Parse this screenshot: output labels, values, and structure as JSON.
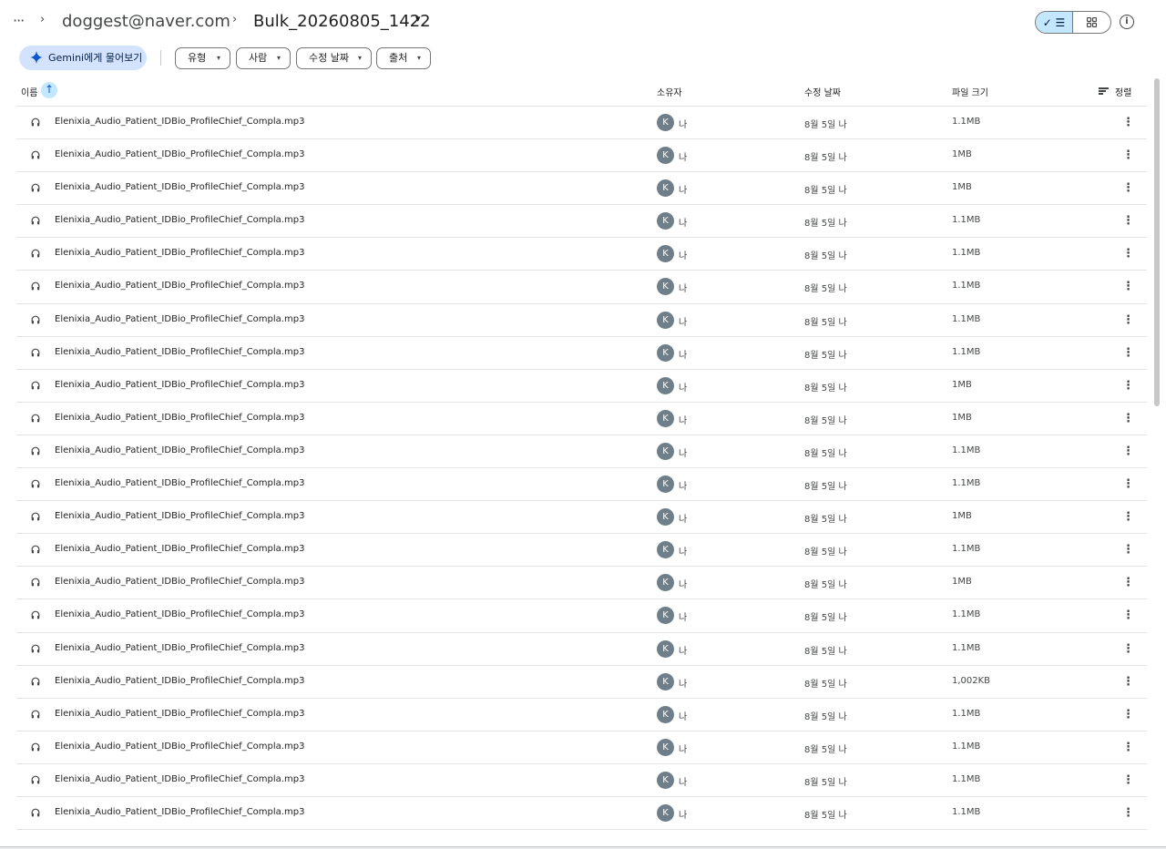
{
  "breadcrumb": {
    "more": "···",
    "separator": "›",
    "user": "doggest@naver.com",
    "folder": "Bulk_20260805_1422",
    "folder_caret": "▾"
  },
  "view_toggle": {
    "list_label": "✓ ☰",
    "grid_icon": "grid-icon",
    "list_selected": true
  },
  "info_icon": {
    "glyph": "i"
  },
  "chips": {
    "gemini": "Gemini에게 물어보기",
    "type": "유형",
    "people": "사람",
    "modified": "수정 날짜",
    "source": "출처",
    "caret": "▾"
  },
  "columns": {
    "name": "이름",
    "sort_arrow": "↑",
    "owner": "소유자",
    "modified": "수정 날짜",
    "size": "파일 크기",
    "sort": "정렬"
  },
  "colors": {
    "accent": "#c2e7ff",
    "gemini_chip": "#d3e3fd",
    "avatar": "#6e7f8a"
  },
  "rows": [
    {
      "name": "Elenixia_Audio_Patient_IDBio_ProfileChief_Compla.mp3",
      "avatar": "K",
      "owner": "나",
      "date": "8월 5일 나",
      "size": "1.1MB",
      "more": "⋮"
    },
    {
      "name": "Elenixia_Audio_Patient_IDBio_ProfileChief_Compla.mp3",
      "avatar": "K",
      "owner": "나",
      "date": "8월 5일 나",
      "size": "1MB",
      "more": "⋮"
    },
    {
      "name": "Elenixia_Audio_Patient_IDBio_ProfileChief_Compla.mp3",
      "avatar": "K",
      "owner": "나",
      "date": "8월 5일 나",
      "size": "1MB",
      "more": "⋮"
    },
    {
      "name": "Elenixia_Audio_Patient_IDBio_ProfileChief_Compla.mp3",
      "avatar": "K",
      "owner": "나",
      "date": "8월 5일 나",
      "size": "1.1MB",
      "more": "⋮"
    },
    {
      "name": "Elenixia_Audio_Patient_IDBio_ProfileChief_Compla.mp3",
      "avatar": "K",
      "owner": "나",
      "date": "8월 5일 나",
      "size": "1.1MB",
      "more": "⋮"
    },
    {
      "name": "Elenixia_Audio_Patient_IDBio_ProfileChief_Compla.mp3",
      "avatar": "K",
      "owner": "나",
      "date": "8월 5일 나",
      "size": "1.1MB",
      "more": "⋮"
    },
    {
      "name": "Elenixia_Audio_Patient_IDBio_ProfileChief_Compla.mp3",
      "avatar": "K",
      "owner": "나",
      "date": "8월 5일 나",
      "size": "1.1MB",
      "more": "⋮"
    },
    {
      "name": "Elenixia_Audio_Patient_IDBio_ProfileChief_Compla.mp3",
      "avatar": "K",
      "owner": "나",
      "date": "8월 5일 나",
      "size": "1.1MB",
      "more": "⋮"
    },
    {
      "name": "Elenixia_Audio_Patient_IDBio_ProfileChief_Compla.mp3",
      "avatar": "K",
      "owner": "나",
      "date": "8월 5일 나",
      "size": "1MB",
      "more": "⋮"
    },
    {
      "name": "Elenixia_Audio_Patient_IDBio_ProfileChief_Compla.mp3",
      "avatar": "K",
      "owner": "나",
      "date": "8월 5일 나",
      "size": "1MB",
      "more": "⋮"
    },
    {
      "name": "Elenixia_Audio_Patient_IDBio_ProfileChief_Compla.mp3",
      "avatar": "K",
      "owner": "나",
      "date": "8월 5일 나",
      "size": "1.1MB",
      "more": "⋮"
    },
    {
      "name": "Elenixia_Audio_Patient_IDBio_ProfileChief_Compla.mp3",
      "avatar": "K",
      "owner": "나",
      "date": "8월 5일 나",
      "size": "1.1MB",
      "more": "⋮"
    },
    {
      "name": "Elenixia_Audio_Patient_IDBio_ProfileChief_Compla.mp3",
      "avatar": "K",
      "owner": "나",
      "date": "8월 5일 나",
      "size": "1MB",
      "more": "⋮"
    },
    {
      "name": "Elenixia_Audio_Patient_IDBio_ProfileChief_Compla.mp3",
      "avatar": "K",
      "owner": "나",
      "date": "8월 5일 나",
      "size": "1.1MB",
      "more": "⋮"
    },
    {
      "name": "Elenixia_Audio_Patient_IDBio_ProfileChief_Compla.mp3",
      "avatar": "K",
      "owner": "나",
      "date": "8월 5일 나",
      "size": "1MB",
      "more": "⋮"
    },
    {
      "name": "Elenixia_Audio_Patient_IDBio_ProfileChief_Compla.mp3",
      "avatar": "K",
      "owner": "나",
      "date": "8월 5일 나",
      "size": "1.1MB",
      "more": "⋮"
    },
    {
      "name": "Elenixia_Audio_Patient_IDBio_ProfileChief_Compla.mp3",
      "avatar": "K",
      "owner": "나",
      "date": "8월 5일 나",
      "size": "1.1MB",
      "more": "⋮"
    },
    {
      "name": "Elenixia_Audio_Patient_IDBio_ProfileChief_Compla.mp3",
      "avatar": "K",
      "owner": "나",
      "date": "8월 5일 나",
      "size": "1,002KB",
      "more": "⋮"
    },
    {
      "name": "Elenixia_Audio_Patient_IDBio_ProfileChief_Compla.mp3",
      "avatar": "K",
      "owner": "나",
      "date": "8월 5일 나",
      "size": "1.1MB",
      "more": "⋮"
    },
    {
      "name": "Elenixia_Audio_Patient_IDBio_ProfileChief_Compla.mp3",
      "avatar": "K",
      "owner": "나",
      "date": "8월 5일 나",
      "size": "1.1MB",
      "more": "⋮"
    },
    {
      "name": "Elenixia_Audio_Patient_IDBio_ProfileChief_Compla.mp3",
      "avatar": "K",
      "owner": "나",
      "date": "8월 5일 나",
      "size": "1.1MB",
      "more": "⋮"
    },
    {
      "name": "Elenixia_Audio_Patient_IDBio_ProfileChief_Compla.mp3",
      "avatar": "K",
      "owner": "나",
      "date": "8월 5일 나",
      "size": "1.1MB",
      "more": "⋮"
    }
  ]
}
